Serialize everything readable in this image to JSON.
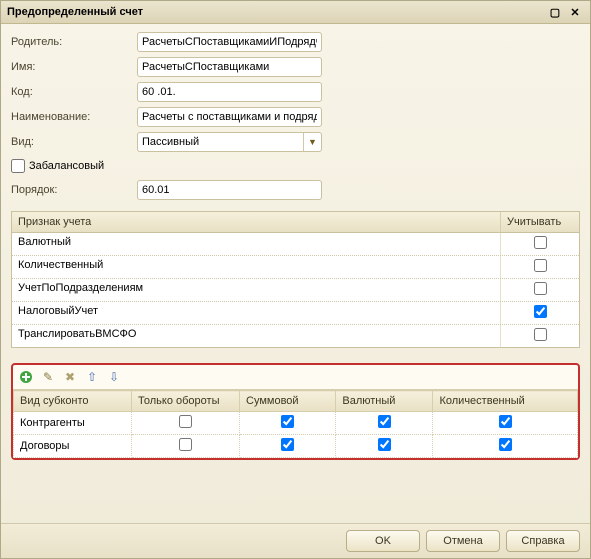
{
  "titlebar": {
    "title": "Предопределенный счет"
  },
  "form": {
    "parent_label": "Родитель:",
    "parent_value": "РасчетыСПоставщикамиИПодрядчик",
    "name_label": "Имя:",
    "name_value": "РасчетыСПоставщиками",
    "code_label": "Код:",
    "code_value": "60 .01.",
    "desc_label": "Наименование:",
    "desc_value": "Расчеты с поставщиками и подрядчи",
    "kind_label": "Вид:",
    "kind_value": "Пассивный",
    "offbalance_label": "Забалансовый",
    "order_label": "Порядок:",
    "order_value": "60.01"
  },
  "props": {
    "col_prop": "Признак учета",
    "col_use": "Учитывать",
    "rows": [
      {
        "label": "Валютный",
        "checked": false
      },
      {
        "label": "Количественный",
        "checked": false
      },
      {
        "label": "УчетПоПодразделениям",
        "checked": false
      },
      {
        "label": "НалоговыйУчет",
        "checked": true
      },
      {
        "label": "ТранслироватьВМСФО",
        "checked": false
      }
    ]
  },
  "subconto": {
    "cols": {
      "kind": "Вид субконто",
      "turnover": "Только обороты",
      "sum": "Суммовой",
      "currency": "Валютный",
      "qty": "Количественный"
    },
    "rows": [
      {
        "kind": "Контрагенты",
        "turnover": false,
        "sum": true,
        "currency": true,
        "qty": true
      },
      {
        "kind": "Договоры",
        "turnover": false,
        "sum": true,
        "currency": true,
        "qty": true
      }
    ]
  },
  "footer": {
    "ok": "OK",
    "cancel": "Отмена",
    "help": "Справка"
  }
}
